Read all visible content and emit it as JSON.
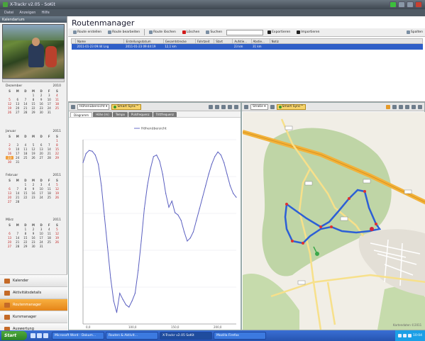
{
  "window": {
    "title": "X-Trackr v2.05 - SoKit"
  },
  "menu": [
    "Datei",
    "Anzeigen",
    "Hilfe"
  ],
  "left": {
    "header": "Kalendarium",
    "calendars": [
      {
        "month": "Dezember",
        "year": "2010"
      },
      {
        "month": "Januar",
        "year": "2011"
      },
      {
        "month": "Februar",
        "year": "2011"
      },
      {
        "month": "März",
        "year": "2011"
      }
    ],
    "weekdays": [
      "S",
      "M",
      "D",
      "M",
      "D",
      "F",
      "S"
    ],
    "nav": [
      {
        "label": "Kalender",
        "icon": "calendar-icon",
        "active": false
      },
      {
        "label": "Aktivitätsdetails",
        "icon": "list-icon",
        "active": false
      },
      {
        "label": "Routenmanager",
        "icon": "route-icon",
        "active": true
      },
      {
        "label": "Kursmanager",
        "icon": "course-icon",
        "active": false
      },
      {
        "label": "Auswertung",
        "icon": "stats-icon",
        "active": false
      }
    ]
  },
  "main": {
    "title": "Routenmanager",
    "toolbar": {
      "buttons": [
        "Route erstellen",
        "Route bearbeiten",
        "Route löschen",
        "Löschen",
        "Suchen"
      ],
      "right_buttons": [
        "Exportieren",
        "Importieren",
        "Spalten"
      ]
    },
    "table": {
      "columns": [
        "",
        "Name",
        "Erstellungsdatum",
        "Gesamtstrecke",
        "Fahrtzeit",
        "Start",
        "Aufstie...",
        "Abstie...",
        "Notiz"
      ],
      "rows": [
        [
          "",
          "2011-01-23 09:44 Lng",
          "2011-01-23 09:44:19",
          "12,1 km",
          "",
          "",
          "23 km",
          "31 km",
          ""
        ]
      ]
    }
  },
  "chart_panel": {
    "dropdown": "Höhenübersicht",
    "smart_btn": "Smart Sync™",
    "tabs": [
      "Diagramm",
      "Höhe (m)",
      "Tempo",
      "Pulsfrequenz",
      "Trittfrequenz"
    ],
    "legend": "Höhenübersicht",
    "chart_data": {
      "type": "line",
      "series": [
        {
          "name": "Höhenübersicht",
          "x": [
            0,
            2,
            4,
            6,
            8,
            10,
            12,
            14,
            16,
            18,
            20,
            22,
            24,
            26,
            28,
            30,
            32,
            34,
            36,
            38,
            40,
            42,
            44,
            46,
            48,
            50,
            52,
            54,
            56,
            58,
            60,
            62,
            64,
            66,
            68,
            70,
            72,
            74,
            76,
            78,
            80,
            82,
            84,
            86,
            88,
            90,
            92,
            94,
            96,
            98,
            100
          ],
          "y": [
            470,
            482,
            486,
            485,
            480,
            468,
            440,
            400,
            360,
            320,
            290,
            275,
            300,
            292,
            285,
            282,
            290,
            300,
            330,
            368,
            410,
            440,
            462,
            478,
            480,
            472,
            455,
            430,
            412,
            420,
            405,
            402,
            395,
            380,
            368,
            372,
            380,
            395,
            410,
            425,
            440,
            455,
            468,
            478,
            484,
            480,
            470,
            455,
            440,
            430,
            425
          ]
        }
      ],
      "xlim": [
        0,
        100
      ],
      "ylim": [
        260,
        500
      ],
      "xticks": [
        "0,0",
        "100,0",
        "150,0",
        "200,0"
      ]
    }
  },
  "map_panel": {
    "dropdown": "Straße",
    "smart_btn": "Smart Sync™",
    "copyright": "Kartendaten ©2011"
  },
  "taskbar": {
    "start": "Start",
    "tasks": [
      "Microsoft Word - Dokum...",
      "Routen & Aktivit...",
      "X-Trackr v2.05 SoKit",
      "Mozilla Firefox"
    ],
    "time": "10:04"
  }
}
